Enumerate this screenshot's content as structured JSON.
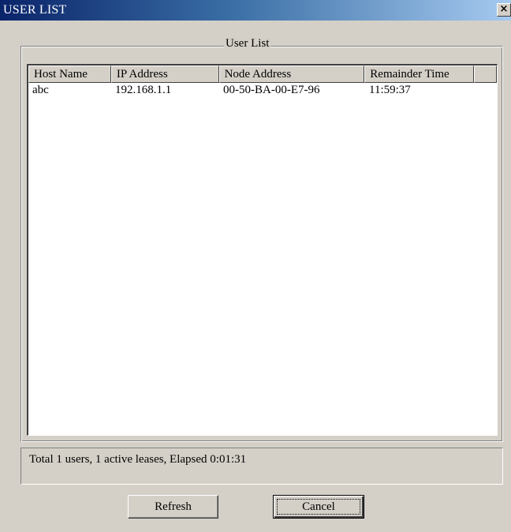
{
  "window": {
    "title": "USER LIST",
    "close_glyph": "×"
  },
  "group": {
    "legend": "User List"
  },
  "table": {
    "columns": [
      "Host Name",
      "IP Address",
      "Node Address",
      "Remainder Time",
      ""
    ],
    "rows": [
      [
        "abc",
        "192.168.1.1",
        "00-50-BA-00-E7-96",
        "11:59:37"
      ]
    ]
  },
  "status": {
    "text": "Total 1 users, 1 active leases, Elapsed  0:01:31"
  },
  "buttons": {
    "refresh": "Refresh",
    "cancel": "Cancel"
  }
}
